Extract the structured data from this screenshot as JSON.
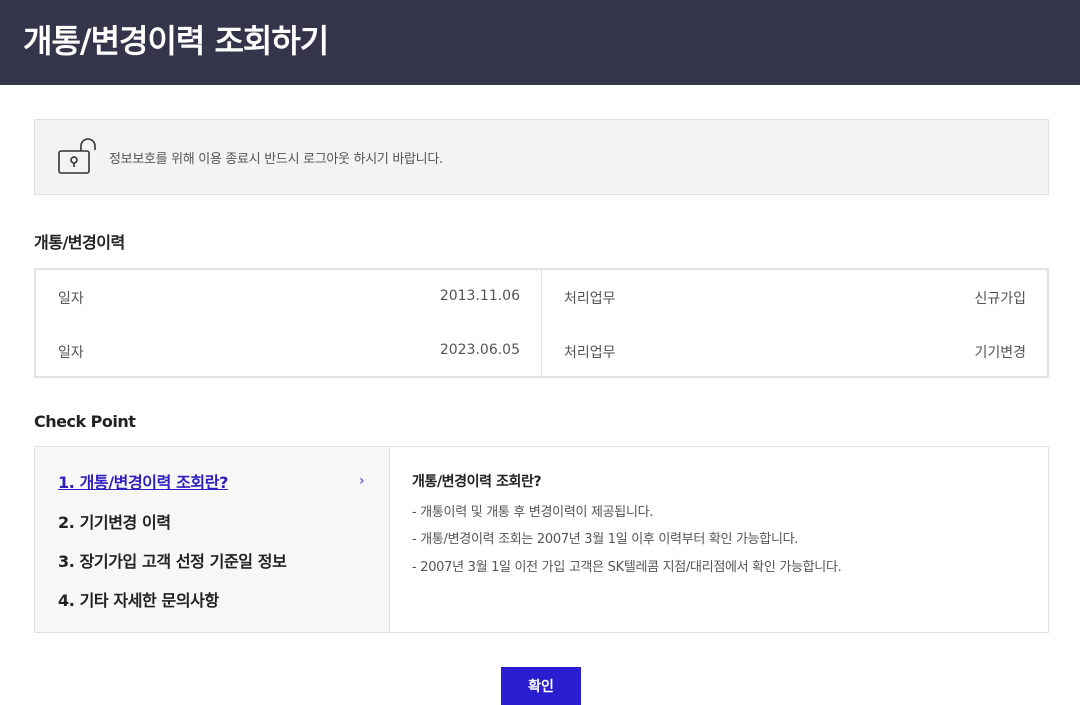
{
  "header": {
    "title": "개통/변경이력 조회하기"
  },
  "notice": {
    "text": "정보보호를 위해 이용 종료시 반드시 로그아웃 하시기 바랍니다.",
    "icon": "unlock-icon"
  },
  "history": {
    "title": "개통/변경이력",
    "rows": [
      {
        "date_label": "일자",
        "date": "2013.11.06",
        "task_label": "처리업무",
        "task": "신규가입"
      },
      {
        "date_label": "일자",
        "date": "2023.06.05",
        "task_label": "처리업무",
        "task": "기기변경"
      }
    ]
  },
  "checkpoint": {
    "title": "Check Point",
    "items": [
      "1. 개통/변경이력 조회란?",
      "2. 기기변경 이력",
      "3. 장기가입 고객 선정 기준일 정보",
      "4. 기타 자세한 문의사항"
    ],
    "active_index": 0,
    "detail_title": "개통/변경이력 조회란?",
    "detail_lines": [
      "-  개통이력 및 개통 후 변경이력이 제공됩니다.",
      "-  개통/변경이력 조회는 2007년 3월 1일 이후 이력부터 확인 가능합니다.",
      "-  2007년 3월 1일 이전 가입 고객은 SK텔레콤 지점/대리점에서 확인 가능합니다."
    ]
  },
  "confirm_label": "확인",
  "colors": {
    "header_bg": "#34344a",
    "accent": "#2b1ed0"
  }
}
